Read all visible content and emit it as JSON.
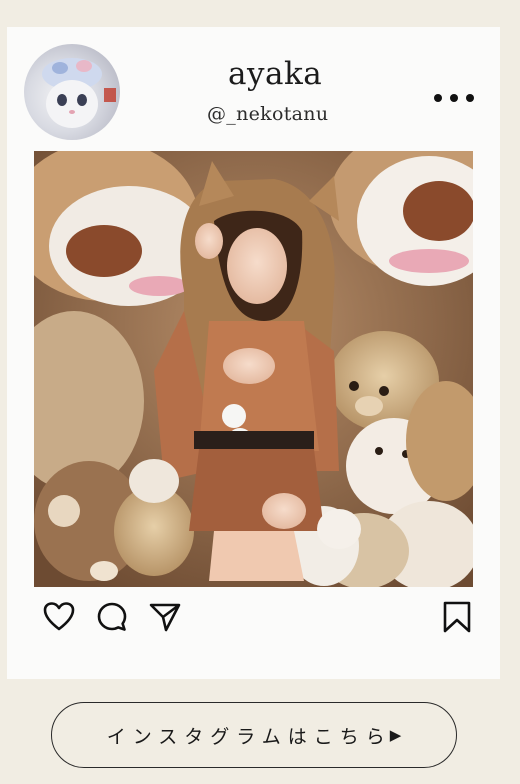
{
  "profile": {
    "name": "ayaka",
    "handle": "@_nekotanu",
    "more_icon": "more-horizontal-icon",
    "avatar_icon": "cat-avatar"
  },
  "post": {
    "photo_description_icon": "post-photo",
    "actions": [
      "heart-icon",
      "comment-icon",
      "send-icon",
      "bookmark-icon"
    ]
  },
  "cta": {
    "label": "インスタグラムはこちら",
    "arrow": "▶"
  },
  "colors": {
    "page_bg": "#f1ede3",
    "card_bg": "#fbfbfa",
    "text": "#1c1c1c"
  }
}
